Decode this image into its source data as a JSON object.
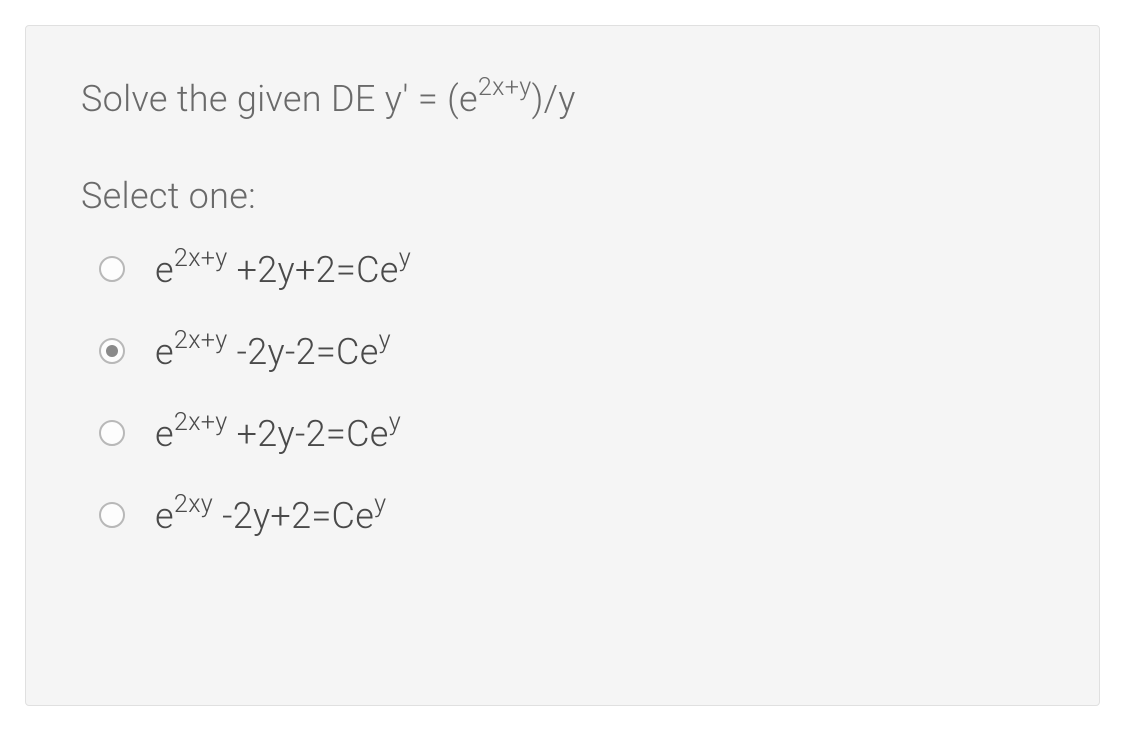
{
  "question": {
    "prefix": "Solve the given DE y' = (e",
    "exp1": "2x+y",
    "suffix": ")/y"
  },
  "select_label": "Select one:",
  "options": [
    {
      "base1": "e",
      "exp1": "2x+y",
      "mid": " +2y+2=Ce",
      "exp2": "y",
      "selected": false
    },
    {
      "base1": "e",
      "exp1": "2x+y",
      "mid": " -2y-2=Ce",
      "exp2": "y",
      "selected": true
    },
    {
      "base1": "e",
      "exp1": "2x+y",
      "mid": " +2y-2=Ce",
      "exp2": "y",
      "selected": false
    },
    {
      "base1": "e",
      "exp1": "2xy",
      "mid": " -2y+2=Ce",
      "exp2": "y",
      "selected": false
    }
  ]
}
